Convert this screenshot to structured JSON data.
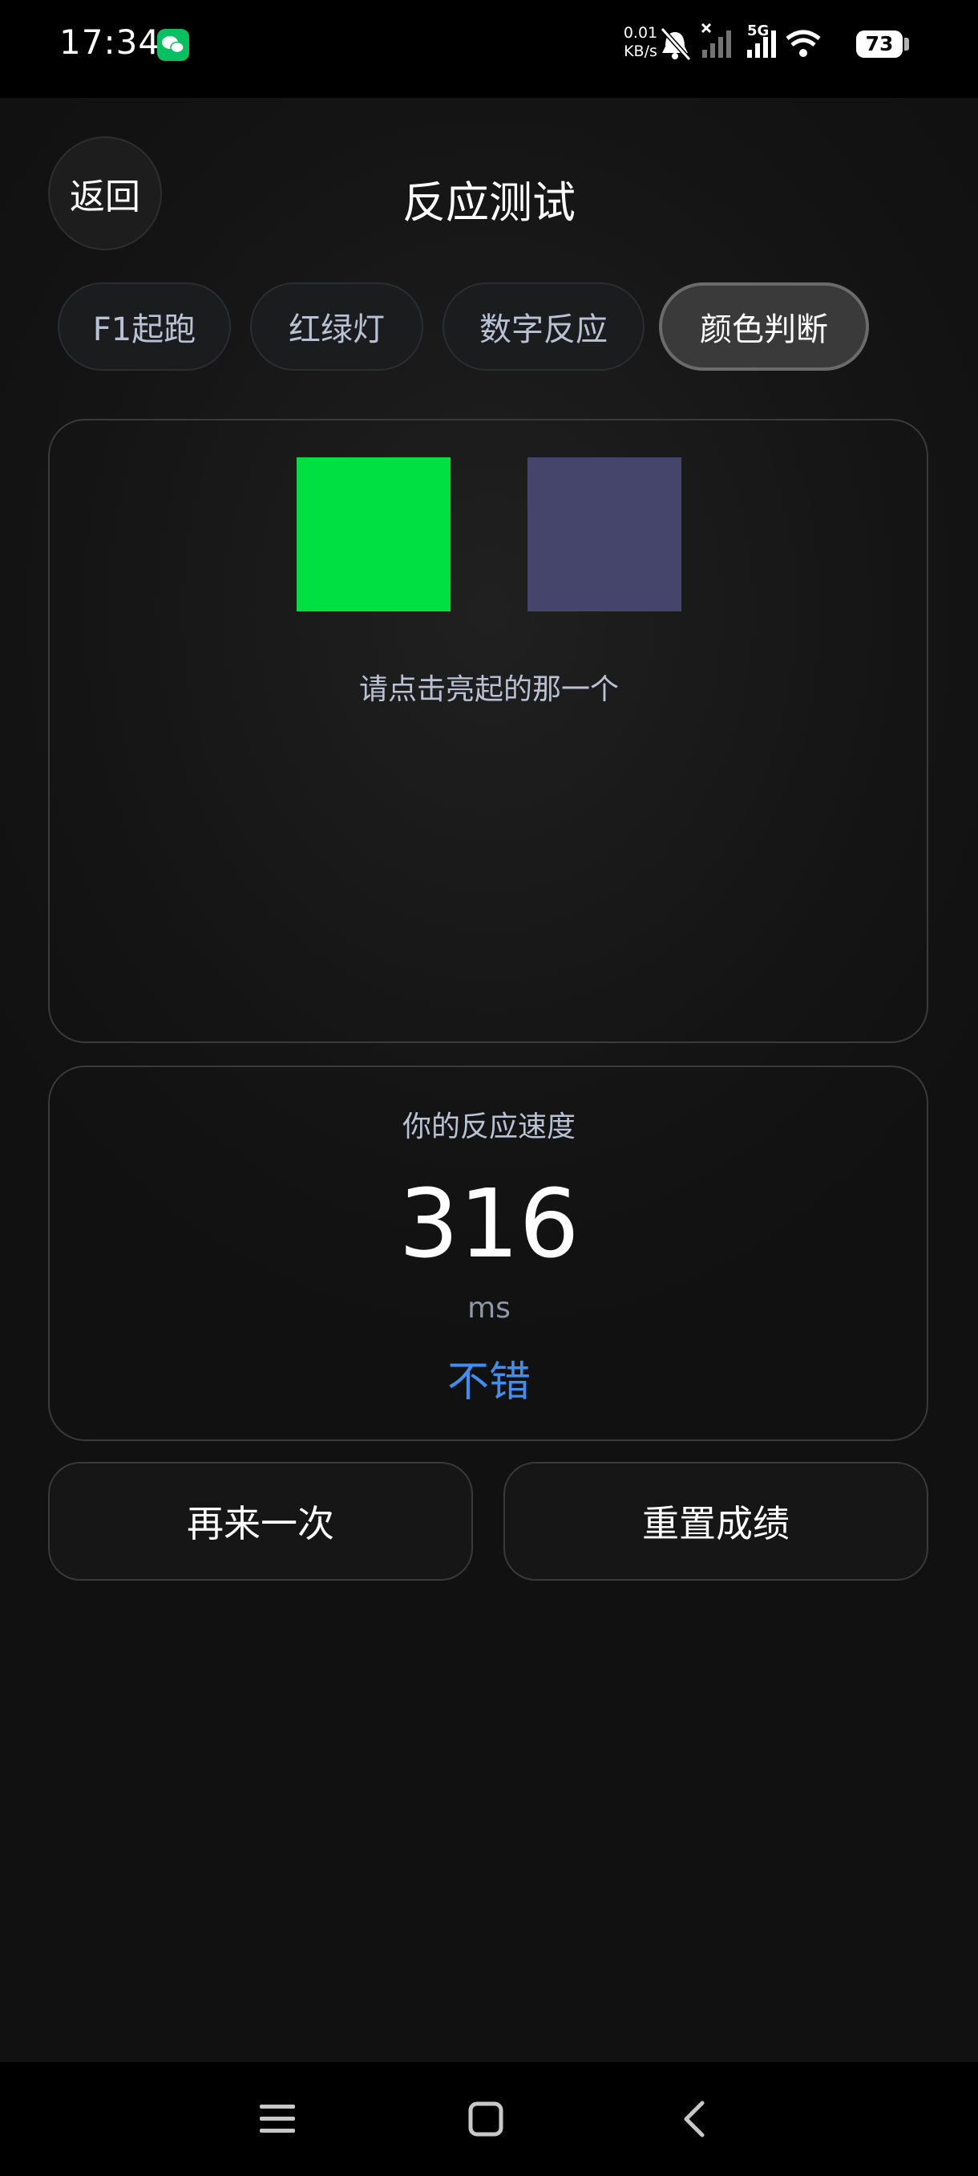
{
  "status_bar": {
    "time": "17:34",
    "net_speed_value": "0.01",
    "net_speed_unit": "KB/s",
    "network_type": "5G",
    "battery": "73"
  },
  "header": {
    "back_label": "返回",
    "title": "反应测试"
  },
  "tabs": [
    {
      "label": "F1起跑",
      "active": false
    },
    {
      "label": "红绿灯",
      "active": false
    },
    {
      "label": "数字反应",
      "active": false
    },
    {
      "label": "颜色判断",
      "active": true
    }
  ],
  "game": {
    "left_color": "#00e043",
    "right_color": "#45456c",
    "lit": "left",
    "instruction": "请点击亮起的那一个"
  },
  "result": {
    "label": "你的反应速度",
    "value": "316",
    "unit": "ms",
    "rating": "不错",
    "rating_color": "#3f8ef0"
  },
  "actions": {
    "retry_label": "再来一次",
    "reset_label": "重置成绩"
  },
  "icons": {
    "wechat": "wechat-icon",
    "mute": "bell-muted-icon",
    "signal": "signal-icon",
    "wifi": "wifi-icon",
    "battery": "battery-icon",
    "menu": "menu-icon",
    "home": "home-icon",
    "back": "back-icon"
  }
}
